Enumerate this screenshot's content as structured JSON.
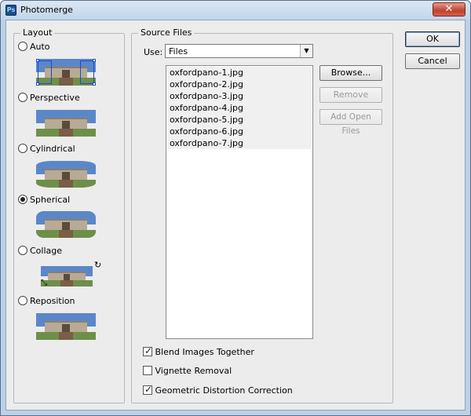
{
  "window": {
    "title": "Photomerge",
    "close_glyph": "✕",
    "app_icon": "Ps"
  },
  "layout": {
    "title": "Layout",
    "options": [
      {
        "label": "Auto",
        "checked": false
      },
      {
        "label": "Perspective",
        "checked": false
      },
      {
        "label": "Cylindrical",
        "checked": false
      },
      {
        "label": "Spherical",
        "checked": true
      },
      {
        "label": "Collage",
        "checked": false
      },
      {
        "label": "Reposition",
        "checked": false
      }
    ]
  },
  "source": {
    "title": "Source Files",
    "use_label": "Use:",
    "use_value": "Files",
    "files": [
      "oxfordpano-1.jpg",
      "oxfordpano-2.jpg",
      "oxfordpano-3.jpg",
      "oxfordpano-4.jpg",
      "oxfordpano-5.jpg",
      "oxfordpano-6.jpg",
      "oxfordpano-7.jpg"
    ],
    "browse_label": "Browse...",
    "remove_label": "Remove",
    "add_open_label": "Add Open Files"
  },
  "options": {
    "blend": {
      "label": "Blend Images Together",
      "checked": true
    },
    "vignette": {
      "label": "Vignette Removal",
      "checked": false
    },
    "geometric": {
      "label": "Geometric Distortion Correction",
      "checked": true
    }
  },
  "buttons": {
    "ok": "OK",
    "cancel": "Cancel"
  },
  "colors": {
    "accent": "#1a49d6",
    "titlebar": "#c3d5ea",
    "close": "#c1402d"
  }
}
